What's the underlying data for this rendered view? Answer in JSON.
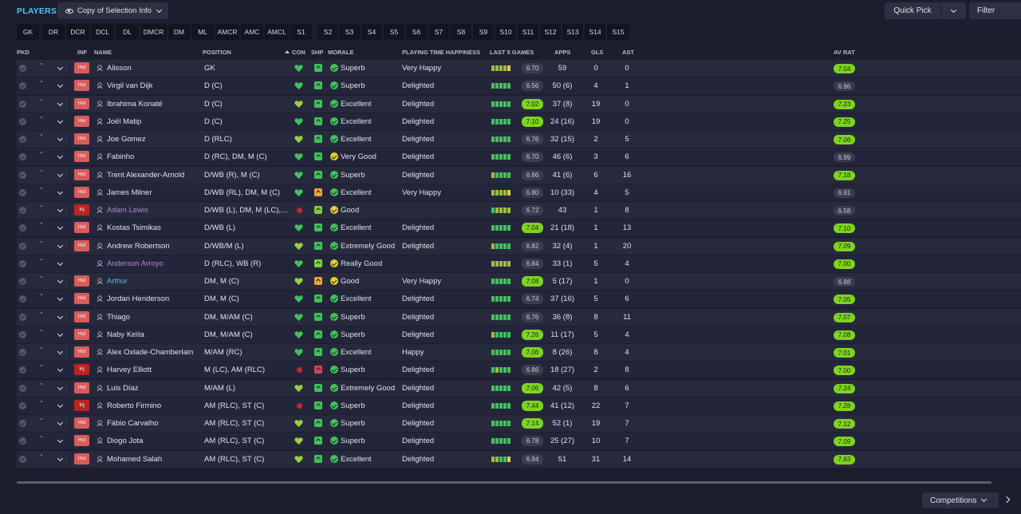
{
  "header": {
    "title": "PLAYERS",
    "copy_button": "Copy of Selection Info",
    "quick_pick": "Quick Pick",
    "filter": "Filter"
  },
  "position_chips": [
    "GK",
    "DR",
    "DCR",
    "DCL",
    "DL",
    "DMCR",
    "DM",
    "ML",
    "AMCR",
    "AMC",
    "AMCL",
    "S1",
    "S2",
    "S3",
    "S4",
    "S5",
    "S6",
    "S7",
    "S8",
    "S9",
    "S10",
    "S11",
    "S12",
    "S13",
    "S14",
    "S15"
  ],
  "columns": {
    "pkd": "PKD",
    "inf": "INF",
    "name": "NAME",
    "position": "POSITION",
    "con": "CON",
    "shp": "SHP",
    "morale": "MORALE",
    "pth": "PLAYING TIME HAPPINESS",
    "last5": "LAST 5 GAMES",
    "apps": "APPS",
    "gls": "GLS",
    "ast": "AST",
    "avrat": "AV RAT"
  },
  "colors": {
    "accent": "#4fc3f7",
    "positive": "#7ed321",
    "injury": "#b82424",
    "holiday": "#d95c5c"
  },
  "players": [
    {
      "inf": "Hol",
      "name": "Alisson",
      "name_color": "default",
      "position": "GK",
      "con": "green",
      "shp": "green",
      "morale_color": "green",
      "morale": "Superb",
      "pth": "Very Happy",
      "bars": [
        "#9fbf3a",
        "#9fbf3a",
        "#9fbf3a",
        "#9fbf3a",
        "#e3cf2f"
      ],
      "form": "6.70",
      "form_style": "dark",
      "apps": "59",
      "gls": "0",
      "ast": "0",
      "avrat": "7.04",
      "avrat_style": "green"
    },
    {
      "inf": "Hol",
      "name": "Virgil van Dijk",
      "name_color": "default",
      "position": "D (C)",
      "con": "green",
      "shp": "green",
      "morale_color": "green",
      "morale": "Superb",
      "pth": "Delighted",
      "bars": [
        "#3ec35a",
        "#3ec35a",
        "#3ec35a",
        "#3ec35a",
        "#3ec35a"
      ],
      "form": "6.56",
      "form_style": "dark",
      "apps": "50 (6)",
      "gls": "4",
      "ast": "1",
      "avrat": "6.96",
      "avrat_style": "dark"
    },
    {
      "inf": "Hol",
      "name": "Ibrahima Konaté",
      "name_color": "default",
      "position": "D (C)",
      "con": "yellowgreen",
      "shp": "green",
      "morale_color": "green",
      "morale": "Excellent",
      "pth": "Delighted",
      "bars": [
        "#3ec35a",
        "#3ec35a",
        "#3ec35a",
        "#3ec35a",
        "#3ec35a"
      ],
      "form": "7.02",
      "form_style": "green",
      "apps": "37 (8)",
      "gls": "19",
      "ast": "0",
      "avrat": "7.23",
      "avrat_style": "green"
    },
    {
      "inf": "Hol",
      "name": "Joël Matip",
      "name_color": "default",
      "position": "D (C)",
      "con": "green",
      "shp": "green",
      "morale_color": "green",
      "morale": "Excellent",
      "pth": "Delighted",
      "bars": [
        "#3ec35a",
        "#3ec35a",
        "#3ec35a",
        "#3ec35a",
        "#3ec35a"
      ],
      "form": "7.10",
      "form_style": "green",
      "apps": "24 (16)",
      "gls": "19",
      "ast": "0",
      "avrat": "7.25",
      "avrat_style": "green"
    },
    {
      "inf": "Hol",
      "name": "Joe Gomez",
      "name_color": "default",
      "position": "D (RLC)",
      "con": "yellowgreen",
      "shp": "green",
      "morale_color": "green",
      "morale": "Excellent",
      "pth": "Delighted",
      "bars": [
        "#3ec35a",
        "#3ec35a",
        "#3ec35a",
        "#3ec35a",
        "#3ec35a"
      ],
      "form": "6.76",
      "form_style": "dark",
      "apps": "32 (15)",
      "gls": "2",
      "ast": "5",
      "avrat": "7.06",
      "avrat_style": "green"
    },
    {
      "inf": "Hol",
      "name": "Fabinho",
      "name_color": "default",
      "position": "D (RC), DM, M (C)",
      "con": "green",
      "shp": "green",
      "morale_color": "yellow",
      "morale": "Very Good",
      "pth": "Delighted",
      "bars": [
        "#3ec35a",
        "#3ec35a",
        "#3ec35a",
        "#3ec35a",
        "#3ec35a"
      ],
      "form": "6.70",
      "form_style": "dark",
      "apps": "46 (6)",
      "gls": "3",
      "ast": "6",
      "avrat": "6.99",
      "avrat_style": "dark"
    },
    {
      "inf": "Hol",
      "name": "Trent Alexander-Arnold",
      "name_color": "default",
      "position": "D/WB (R), M (C)",
      "con": "green",
      "shp": "green",
      "morale_color": "green",
      "morale": "Superb",
      "pth": "Delighted",
      "bars": [
        "#9fbf3a",
        "#3ec35a",
        "#3ec35a",
        "#3ec35a",
        "#3ec35a"
      ],
      "form": "6.86",
      "form_style": "dark",
      "apps": "41 (6)",
      "gls": "6",
      "ast": "16",
      "avrat": "7.18",
      "avrat_style": "green"
    },
    {
      "inf": "Hol",
      "name": "James Milner",
      "name_color": "default",
      "position": "D/WB (RL), DM, M (C)",
      "con": "green",
      "shp": "orange",
      "morale_color": "green",
      "morale": "Excellent",
      "pth": "Very Happy",
      "bars": [
        "#9fbf3a",
        "#9fbf3a",
        "#9fbf3a",
        "#9fbf3a",
        "#e3cf2f"
      ],
      "form": "6.80",
      "form_style": "dark",
      "apps": "10 (33)",
      "gls": "4",
      "ast": "5",
      "avrat": "6.91",
      "avrat_style": "dark"
    },
    {
      "inf": "Inj",
      "name": "Adam Lewis",
      "name_color": "purple",
      "position": "D/WB (L), DM, M (LC),...",
      "con": "dot",
      "shp": "yellowgreen",
      "morale_color": "yellow",
      "morale": "Good",
      "pth": "",
      "bars": [
        "#3ec35a",
        "#9fbf3a",
        "#9fbf3a",
        "#9fbf3a",
        "#9fbf3a"
      ],
      "form": "6.72",
      "form_style": "dark",
      "apps": "43",
      "gls": "1",
      "ast": "8",
      "avrat": "6.58",
      "avrat_style": "dark"
    },
    {
      "inf": "Hol",
      "name": "Kostas Tsimikas",
      "name_color": "default",
      "position": "D/WB (L)",
      "con": "green",
      "shp": "green",
      "morale_color": "green",
      "morale": "Excellent",
      "pth": "Delighted",
      "bars": [
        "#3ec35a",
        "#3ec35a",
        "#3ec35a",
        "#3ec35a",
        "#3ec35a"
      ],
      "form": "7.04",
      "form_style": "green",
      "apps": "21 (18)",
      "gls": "1",
      "ast": "13",
      "avrat": "7.10",
      "avrat_style": "green"
    },
    {
      "inf": "Hol",
      "name": "Andrew Robertson",
      "name_color": "default",
      "position": "D/WB/M (L)",
      "con": "yellowgreen",
      "shp": "green",
      "morale_color": "green",
      "morale": "Extremely Good",
      "pth": "Delighted",
      "bars": [
        "#9fbf3a",
        "#3ec35a",
        "#3ec35a",
        "#3ec35a",
        "#3ec35a"
      ],
      "form": "6.82",
      "form_style": "dark",
      "apps": "32 (4)",
      "gls": "1",
      "ast": "20",
      "avrat": "7.09",
      "avrat_style": "green"
    },
    {
      "inf": "",
      "name": "Anderson Arroyo",
      "name_color": "purple",
      "position": "D (RLC), WB (R)",
      "con": "green",
      "shp": "yellowgreen",
      "morale_color": "yellow",
      "morale": "Really Good",
      "pth": "",
      "bars": [
        "#9fbf3a",
        "#9fbf3a",
        "#9fbf3a",
        "#9fbf3a",
        "#9fbf3a"
      ],
      "form": "6.84",
      "form_style": "dark",
      "apps": "33 (1)",
      "gls": "5",
      "ast": "4",
      "avrat": "7.00",
      "avrat_style": "green"
    },
    {
      "inf": "Hol",
      "name": "Arthur",
      "name_color": "blue",
      "position": "DM, M (C)",
      "con": "yellowgreen",
      "shp": "orange",
      "morale_color": "yellow",
      "morale": "Good",
      "pth": "Very Happy",
      "bars": [
        "#3ec35a",
        "#3ec35a",
        "#3ec35a",
        "#3ec35a",
        "#3ec35a"
      ],
      "form": "7.08",
      "form_style": "green",
      "apps": "5 (17)",
      "gls": "1",
      "ast": "0",
      "avrat": "6.88",
      "avrat_style": "dark"
    },
    {
      "inf": "Hol",
      "name": "Jordan Henderson",
      "name_color": "default",
      "position": "DM, M (C)",
      "con": "green",
      "shp": "green",
      "morale_color": "green",
      "morale": "Excellent",
      "pth": "Delighted",
      "bars": [
        "#3ec35a",
        "#3ec35a",
        "#3ec35a",
        "#3ec35a",
        "#3ec35a"
      ],
      "form": "6.74",
      "form_style": "dark",
      "apps": "37 (16)",
      "gls": "5",
      "ast": "6",
      "avrat": "7.05",
      "avrat_style": "green"
    },
    {
      "inf": "Hol",
      "name": "Thiago",
      "name_color": "default",
      "position": "DM, M/AM (C)",
      "con": "green",
      "shp": "green",
      "morale_color": "green",
      "morale": "Superb",
      "pth": "Delighted",
      "bars": [
        "#3ec35a",
        "#3ec35a",
        "#3ec35a",
        "#3ec35a",
        "#3ec35a"
      ],
      "form": "6.76",
      "form_style": "dark",
      "apps": "36 (8)",
      "gls": "8",
      "ast": "11",
      "avrat": "7.07",
      "avrat_style": "green"
    },
    {
      "inf": "Hol",
      "name": "Naby Keïta",
      "name_color": "default",
      "position": "DM, M/AM (C)",
      "con": "green",
      "shp": "green",
      "morale_color": "green",
      "morale": "Superb",
      "pth": "Delighted",
      "bars": [
        "#9fbf3a",
        "#3ec35a",
        "#3ec35a",
        "#3ec35a",
        "#3ec35a"
      ],
      "form": "7.26",
      "form_style": "green",
      "apps": "11 (17)",
      "gls": "5",
      "ast": "4",
      "avrat": "7.08",
      "avrat_style": "green"
    },
    {
      "inf": "Hol",
      "name": "Alex Oxlade-Chamberlain",
      "name_color": "default",
      "position": "M/AM (RC)",
      "con": "green",
      "shp": "green",
      "morale_color": "green",
      "morale": "Excellent",
      "pth": "Happy",
      "bars": [
        "#3ec35a",
        "#3ec35a",
        "#3ec35a",
        "#3ec35a",
        "#3ec35a"
      ],
      "form": "7.06",
      "form_style": "green",
      "apps": "8 (26)",
      "gls": "8",
      "ast": "4",
      "avrat": "7.01",
      "avrat_style": "green"
    },
    {
      "inf": "Inj",
      "name": "Harvey Elliott",
      "name_color": "default",
      "position": "M (LC), AM (RLC)",
      "con": "dot",
      "shp": "red",
      "morale_color": "green",
      "morale": "Superb",
      "pth": "Delighted",
      "bars": [
        "#3ec35a",
        "#9fbf3a",
        "#3ec35a",
        "#3ec35a",
        "#3ec35a"
      ],
      "form": "6.86",
      "form_style": "dark",
      "apps": "18 (27)",
      "gls": "2",
      "ast": "8",
      "avrat": "7.00",
      "avrat_style": "green"
    },
    {
      "inf": "Hol",
      "name": "Luis Díaz",
      "name_color": "default",
      "position": "M/AM (L)",
      "con": "yellowgreen",
      "shp": "green",
      "morale_color": "green",
      "morale": "Extremely Good",
      "pth": "Delighted",
      "bars": [
        "#3ec35a",
        "#3ec35a",
        "#3ec35a",
        "#3ec35a",
        "#3ec35a"
      ],
      "form": "7.06",
      "form_style": "green",
      "apps": "42 (5)",
      "gls": "8",
      "ast": "6",
      "avrat": "7.24",
      "avrat_style": "green"
    },
    {
      "inf": "Inj",
      "name": "Roberto Firmino",
      "name_color": "default",
      "position": "AM (RLC), ST (C)",
      "con": "dot",
      "shp": "green",
      "morale_color": "green",
      "morale": "Superb",
      "pth": "Delighted",
      "bars": [
        "#3ec35a",
        "#3ec35a",
        "#3ec35a",
        "#3ec35a",
        "#3ec35a"
      ],
      "form": "7.44",
      "form_style": "green",
      "apps": "41 (12)",
      "gls": "22",
      "ast": "7",
      "avrat": "7.28",
      "avrat_style": "green"
    },
    {
      "inf": "Hol",
      "name": "Fábio Carvalho",
      "name_color": "default",
      "position": "AM (RLC), ST (C)",
      "con": "yellowgreen",
      "shp": "green",
      "morale_color": "green",
      "morale": "Superb",
      "pth": "Delighted",
      "bars": [
        "#3ec35a",
        "#3ec35a",
        "#3ec35a",
        "#3ec35a",
        "#3ec35a"
      ],
      "form": "7.14",
      "form_style": "green",
      "apps": "52 (1)",
      "gls": "19",
      "ast": "7",
      "avrat": "7.12",
      "avrat_style": "green"
    },
    {
      "inf": "Hol",
      "name": "Diogo Jota",
      "name_color": "default",
      "position": "AM (RLC), ST (C)",
      "con": "yellowgreen",
      "shp": "green",
      "morale_color": "green",
      "morale": "Superb",
      "pth": "Delighted",
      "bars": [
        "#3ec35a",
        "#3ec35a",
        "#3ec35a",
        "#3ec35a",
        "#3ec35a"
      ],
      "form": "6.78",
      "form_style": "dark",
      "apps": "25 (27)",
      "gls": "10",
      "ast": "7",
      "avrat": "7.09",
      "avrat_style": "green"
    },
    {
      "inf": "Hol",
      "name": "Mohamed Salah",
      "name_color": "default",
      "position": "AM (RLC), ST (C)",
      "con": "yellowgreen",
      "shp": "green",
      "morale_color": "green",
      "morale": "Excellent",
      "pth": "Delighted",
      "bars": [
        "#9fbf3a",
        "#9fbf3a",
        "#3ec35a",
        "#3ec35a",
        "#e3cf2f"
      ],
      "form": "6.94",
      "form_style": "dark",
      "apps": "51",
      "gls": "31",
      "ast": "14",
      "avrat": "7.63",
      "avrat_style": "green"
    }
  ],
  "footer": {
    "competitions": "Competitions"
  }
}
